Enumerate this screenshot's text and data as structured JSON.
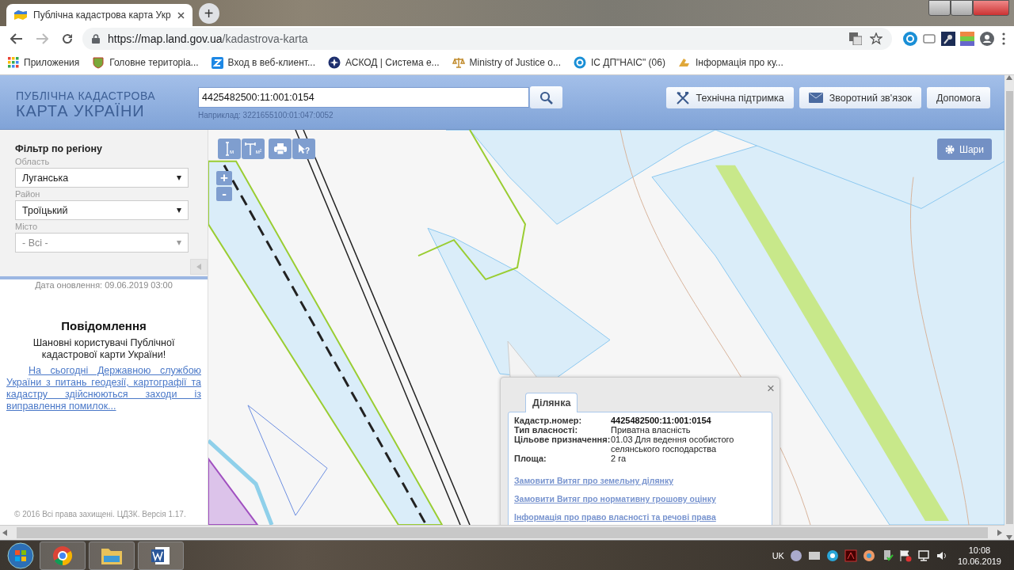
{
  "browser": {
    "tab_title": "Публічна кадастрова карта Укр",
    "new_tab": "+",
    "url_host": "https://map.land.gov.ua",
    "url_path": "/kadastrova-karta",
    "bookmarks": [
      {
        "kind": "apps",
        "label": "Приложения"
      },
      {
        "kind": "emblem",
        "label": "Головне територіа..."
      },
      {
        "kind": "square",
        "label": "Вход в веб-клиент..."
      },
      {
        "kind": "star",
        "label": "АСКОД | Система е..."
      },
      {
        "kind": "scales",
        "label": "Ministry of Justice o..."
      },
      {
        "kind": "ring",
        "label": "ІС ДП\"НАІС\" (06)"
      },
      {
        "kind": "hand",
        "label": "Інформація про ку..."
      }
    ]
  },
  "header": {
    "logo_line_1": "ПУБЛІЧНА КАДАСТРОВА",
    "logo_line_2": "КАРТА УКРАЇНИ",
    "search_value": "4425482500:11:001:0154",
    "search_hint": "Наприклад: 3221655100:01:047:0052",
    "buttons": [
      {
        "kind": "tools",
        "label": "Технічна підтримка"
      },
      {
        "kind": "mail",
        "label": "Зворотний зв'язок"
      },
      {
        "kind": "plain",
        "label": "Допомога"
      }
    ]
  },
  "sidebar": {
    "filter_title": "Фільтр по регіону",
    "fields": [
      {
        "label": "Область",
        "value": "Луганська",
        "disabled": false
      },
      {
        "label": "Район",
        "value": "Троїцький",
        "disabled": false
      },
      {
        "label": "Місто",
        "value": "- Всі -",
        "disabled": true
      }
    ],
    "update_date": "Дата оновлення: 09.06.2019 03:00",
    "notice_title": "Повідомлення",
    "notice_greeting": "Шановні користувачі Публічної кадастрової карти України!",
    "notice_link": "На сьогодні Державною службою України з питань геодезії, картографії та кадастру здійснюються заходи із виправлення помилок...",
    "copyright": "© 2016 Всі права захищені. ЦДЗК. Версія 1.17."
  },
  "map": {
    "tools": [
      {
        "kind": "length",
        "unit": "м"
      },
      {
        "kind": "area",
        "unit": "м²"
      },
      {
        "kind": "print"
      },
      {
        "kind": "identify",
        "unit": "?"
      }
    ],
    "zoom_in": "+",
    "zoom_out": "-",
    "layers_label": "Шари",
    "popup": {
      "tab": "Ділянка",
      "close": "×",
      "rows": [
        {
          "label": "Кадастр.номер:",
          "value": "4425482500:11:001:0154",
          "bold": true
        },
        {
          "label": "Тип власності:",
          "value": "Приватна власність",
          "bold": false
        },
        {
          "label": "Цільове призначення:",
          "value": "01.03 Для ведення особистого селянського господарства",
          "bold": false
        },
        {
          "label": "Площа:",
          "value": "2 га",
          "bold": false
        }
      ],
      "links": [
        "Замовити Витяг про земельну ділянку",
        "Замовити Витяг про нормативну грошову оцінку",
        "Інформація про право власності та речові права"
      ]
    }
  },
  "taskbar": {
    "language": "UK",
    "time": "10:08",
    "date": "10.06.2019"
  }
}
